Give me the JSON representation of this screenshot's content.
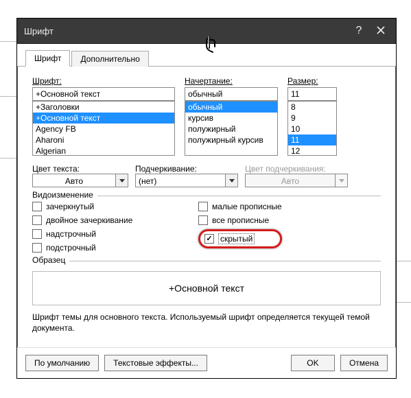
{
  "window": {
    "title": "Шрифт"
  },
  "tabs": {
    "font": "Шрифт",
    "advanced": "Дополнительно"
  },
  "font": {
    "label": "Шрифт:",
    "value": "+Основной текст",
    "items": [
      "+Заголовки",
      "+Основной текст",
      "Agency FB",
      "Aharoni",
      "Algerian"
    ],
    "selected": "+Основной текст"
  },
  "style": {
    "label": "Начертание:",
    "value": "обычный",
    "items": [
      "обычный",
      "курсив",
      "полужирный",
      "полужирный курсив"
    ],
    "selected": "обычный"
  },
  "size": {
    "label": "Размер:",
    "value": "11",
    "items": [
      "8",
      "9",
      "10",
      "11",
      "12"
    ],
    "selected": "11"
  },
  "color": {
    "label": "Цвет текста:",
    "value": "Авто"
  },
  "underline": {
    "label": "Подчеркивание:",
    "value": "(нет)"
  },
  "ul_color": {
    "label": "Цвет подчеркивания:",
    "value": "Авто"
  },
  "effects": {
    "legend": "Видоизменение",
    "strike": "зачеркнутый",
    "dstrike": "двойное зачеркивание",
    "superscript": "надстрочный",
    "subscript": "подстрочный",
    "smallcaps": "малые прописные",
    "allcaps": "все прописные",
    "hidden": "скрытый",
    "hidden_checked": true
  },
  "sample": {
    "legend": "Образец",
    "text": "+Основной текст"
  },
  "desc": "Шрифт темы для основного текста. Используемый шрифт определяется текущей темой документа.",
  "buttons": {
    "default": "По умолчанию",
    "texteffects": "Текстовые эффекты...",
    "ok": "OK",
    "cancel": "Отмена"
  }
}
